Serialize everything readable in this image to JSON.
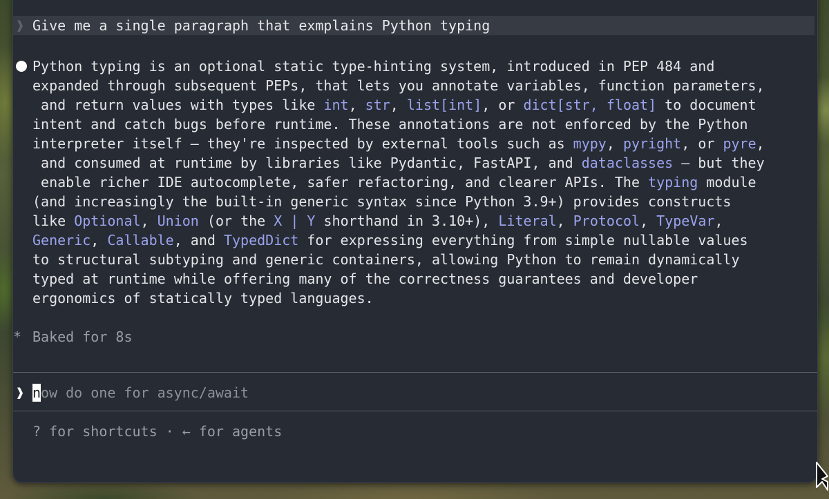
{
  "conversation": {
    "previous_prompt": "Give me a single paragraph that exmplains Python typing",
    "response_lines": [
      [
        {
          "t": "Python typing is an optional static type-hinting system, introduced in PEP 484 and"
        }
      ],
      [
        {
          "t": "expanded through subsequent PEPs, that lets you annotate variables, function parameters,"
        }
      ],
      [
        {
          "t": " and return values with types like "
        },
        {
          "t": "int",
          "c": 1
        },
        {
          "t": ", "
        },
        {
          "t": "str",
          "c": 1
        },
        {
          "t": ", "
        },
        {
          "t": "list[int]",
          "c": 1
        },
        {
          "t": ", or "
        },
        {
          "t": "dict[str, float]",
          "c": 1
        },
        {
          "t": " to document"
        }
      ],
      [
        {
          "t": "intent and catch bugs before runtime. These annotations are not enforced by the Python"
        }
      ],
      [
        {
          "t": "interpreter itself — they're inspected by external tools such as "
        },
        {
          "t": "mypy",
          "c": 1
        },
        {
          "t": ", "
        },
        {
          "t": "pyright",
          "c": 1
        },
        {
          "t": ", or "
        },
        {
          "t": "pyre",
          "c": 1
        },
        {
          "t": ","
        }
      ],
      [
        {
          "t": " and consumed at runtime by libraries like Pydantic, FastAPI, and "
        },
        {
          "t": "dataclasses",
          "c": 1
        },
        {
          "t": " — but they"
        }
      ],
      [
        {
          "t": " enable richer IDE autocomplete, safer refactoring, and clearer APIs. The "
        },
        {
          "t": "typing",
          "c": 1
        },
        {
          "t": " module"
        }
      ],
      [
        {
          "t": "(and increasingly the built-in generic syntax since Python 3.9+) provides constructs"
        }
      ],
      [
        {
          "t": "like "
        },
        {
          "t": "Optional",
          "c": 1
        },
        {
          "t": ", "
        },
        {
          "t": "Union",
          "c": 1
        },
        {
          "t": " (or the "
        },
        {
          "t": "X | Y",
          "c": 1
        },
        {
          "t": " shorthand in 3.10+), "
        },
        {
          "t": "Literal",
          "c": 1
        },
        {
          "t": ", "
        },
        {
          "t": "Protocol",
          "c": 1
        },
        {
          "t": ", "
        },
        {
          "t": "TypeVar",
          "c": 1
        },
        {
          "t": ","
        }
      ],
      [
        {
          "t": "Generic",
          "c": 1
        },
        {
          "t": ", "
        },
        {
          "t": "Callable",
          "c": 1
        },
        {
          "t": ", and "
        },
        {
          "t": "TypedDict",
          "c": 1
        },
        {
          "t": " for expressing everything from simple nullable values"
        }
      ],
      [
        {
          "t": "to structural subtyping and generic containers, allowing Python to remain dynamically"
        }
      ],
      [
        {
          "t": "typed at runtime while offering many of the correctness guarantees and developer"
        }
      ],
      [
        {
          "t": "ergonomics of statically typed languages."
        }
      ]
    ],
    "status": {
      "symbol": "*",
      "text": "Baked for 8s"
    }
  },
  "input": {
    "chevron": "❱",
    "cursor_char": "n",
    "text": "ow do one for async/await"
  },
  "footer": {
    "hint": "? for shortcuts · ← for agents"
  },
  "icons": {
    "prompt_chevron": "chevron-right-icon",
    "bullet": "bullet-dot-icon",
    "status": "asterisk-icon",
    "mouse": "mouse-pointer-icon"
  },
  "colors": {
    "terminal_bg": "#272b33",
    "code_accent": "#9aa3ee",
    "dim_text": "#9a9ea6"
  }
}
